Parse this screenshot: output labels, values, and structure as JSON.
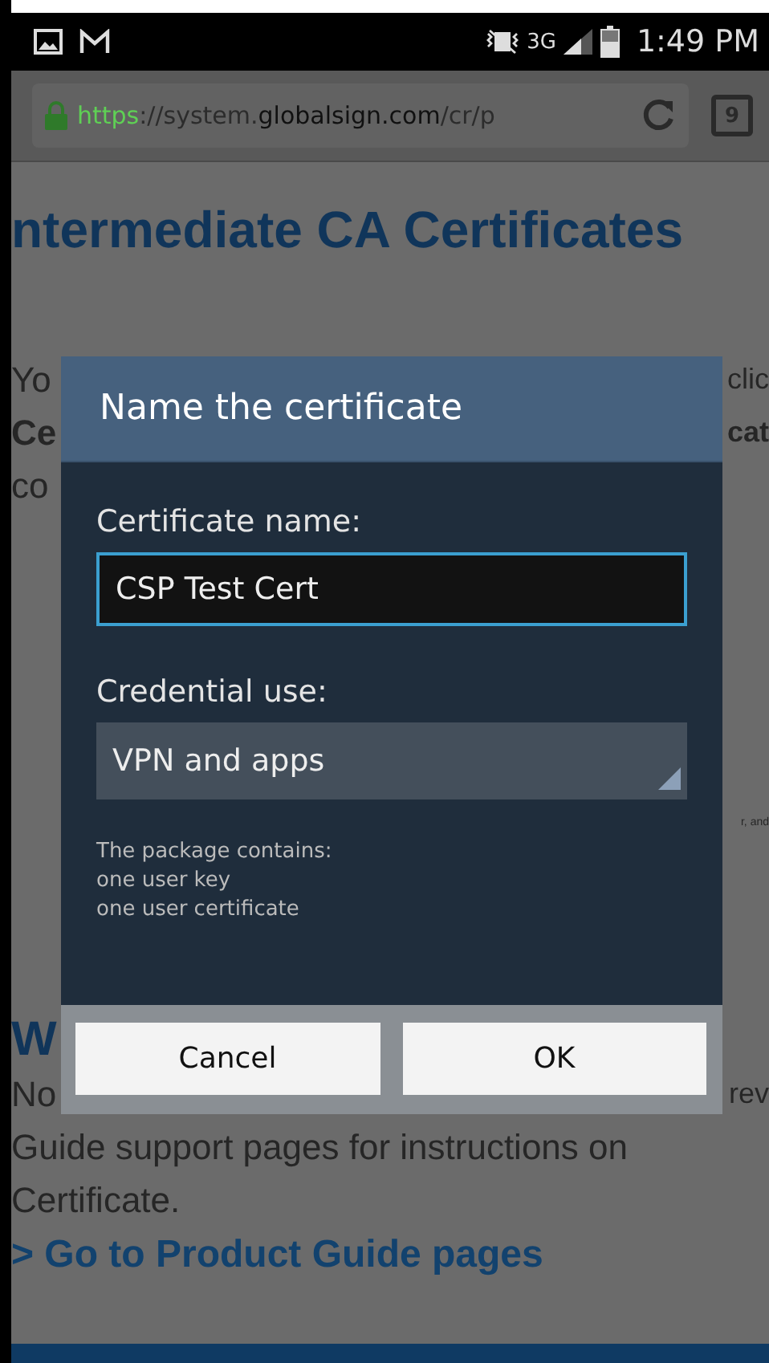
{
  "status_bar": {
    "time": "1:49 PM",
    "network": "3G"
  },
  "browser": {
    "url_parts": [
      {
        "kind": "scheme",
        "text": "https"
      },
      {
        "kind": "dim",
        "text": "://system."
      },
      {
        "kind": "domain",
        "text": "globalsign.com"
      },
      {
        "kind": "dim",
        "text": "/cr/p"
      }
    ],
    "tab_count": "9"
  },
  "page": {
    "heading": "ntermediate CA Certificates",
    "lines": [
      {
        "left": "Yo",
        "right": "clic",
        "bold": false
      },
      {
        "left": "Ce",
        "right": "cat",
        "bold": true
      },
      {
        "left": "co",
        "bold": false
      }
    ],
    "side_note": "r, and",
    "heading_2": "W",
    "lines_2": [
      {
        "left": "No",
        "right": "rev"
      }
    ],
    "paragraph": [
      "Guide support pages for instructions on",
      "Certificate."
    ],
    "link": "> Go to Product Guide pages"
  },
  "dialog": {
    "title": "Name the certificate",
    "name_label": "Certificate name:",
    "name_value": "CSP Test Cert",
    "use_label": "Credential use:",
    "use_value": "VPN and apps",
    "info": [
      "The package contains:",
      "one user key",
      "one user certificate"
    ],
    "buttons": [
      "Cancel",
      "OK"
    ]
  }
}
